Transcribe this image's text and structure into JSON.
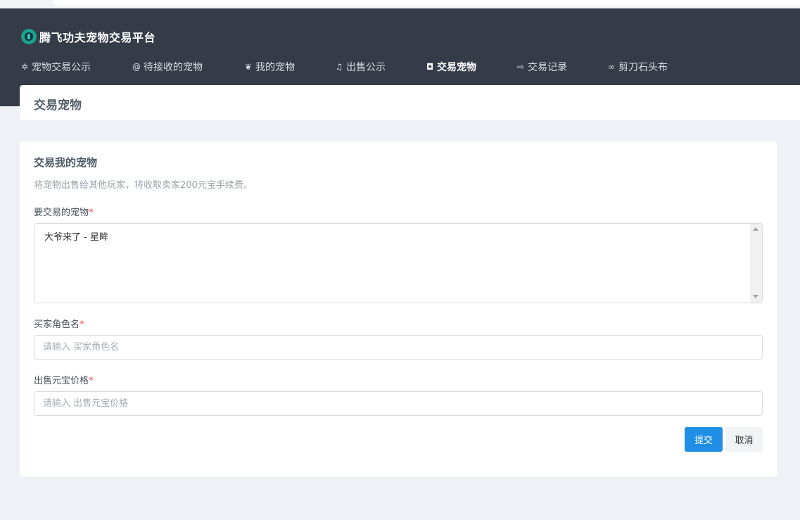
{
  "app": {
    "title": "腾飞功夫宠物交易平台"
  },
  "nav": {
    "items": [
      {
        "label": "宠物交易公示",
        "icon": "bug-icon",
        "glyph": "✲",
        "width": 159
      },
      {
        "label": "待接收的宠物",
        "icon": "at-icon",
        "glyph": "@",
        "width": 159
      },
      {
        "label": "我的宠物",
        "icon": "cat-icon",
        "glyph": "❦",
        "width": 129
      },
      {
        "label": "出售公示",
        "icon": "bell-icon",
        "glyph": "♫",
        "width": 129
      },
      {
        "label": "交易宠物",
        "icon": "shopping-bag-icon",
        "glyph": "◘",
        "width": 129
      },
      {
        "label": "交易记录",
        "icon": "sign-out-icon",
        "glyph": "⇨",
        "width": 129
      },
      {
        "label": "剪刀石头布",
        "icon": "gamepad-icon",
        "glyph": "∞",
        "width": 110
      }
    ],
    "active_index": 4
  },
  "page": {
    "title": "交易宠物"
  },
  "form": {
    "title": "交易我的宠物",
    "subtitle": "将宠物出售给其他玩家，将收取卖家200元宝手续费。",
    "pet_label": "要交易的宠物",
    "pet_selected": "大爷来了 - 星眸",
    "buyer_label": "买家角色名",
    "buyer_placeholder": "请输入 买家角色名",
    "price_label": "出售元宝价格",
    "price_placeholder": "请输入 出售元宝价格",
    "required_mark": "*",
    "submit_label": "提交",
    "cancel_label": "取消"
  },
  "colors": {
    "header_bg": "#353c48",
    "primary": "#1f8ee4",
    "required": "#e74c3c",
    "page_bg": "#eef1f5"
  }
}
